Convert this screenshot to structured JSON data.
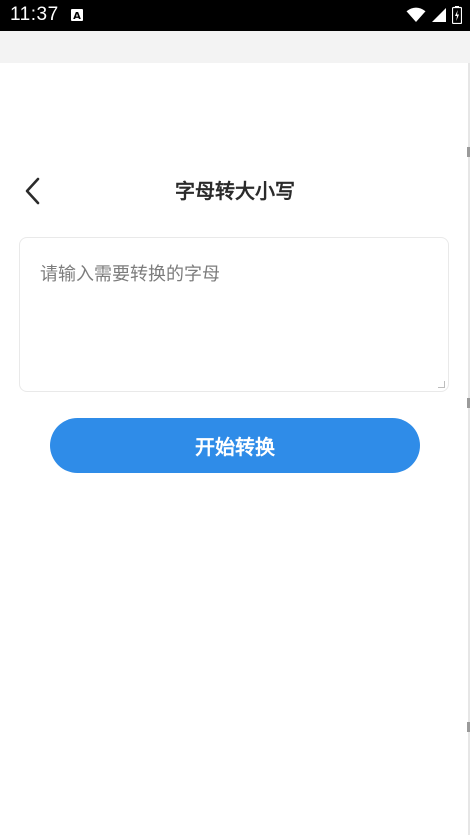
{
  "status_bar": {
    "time": "11:37",
    "icons": [
      "notification-a-icon",
      "wifi-icon",
      "signal-icon",
      "battery-icon"
    ]
  },
  "header": {
    "back_icon": "chevron-left-icon",
    "title": "字母转大小写"
  },
  "input": {
    "placeholder": "请输入需要转换的字母",
    "value": ""
  },
  "action": {
    "label": "开始转换"
  },
  "colors": {
    "primary": "#2f8ce8",
    "status_bar_bg": "#000000",
    "band_bg": "#f3f3f3",
    "title": "#2b2b2b",
    "placeholder": "#7d7d7d"
  }
}
